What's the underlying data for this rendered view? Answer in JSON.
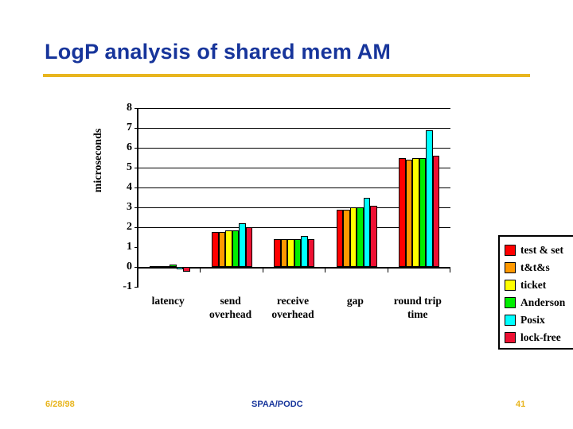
{
  "slide": {
    "title": "LogP analysis of shared mem AM",
    "title_color": "#17359b",
    "rule_color": "#e8b51e"
  },
  "footer": {
    "date": "6/28/98",
    "center": "SPAA/PODC",
    "page": "41",
    "date_color": "#e8b51e",
    "center_color": "#17359b",
    "page_color": "#e8b51e"
  },
  "chart_data": {
    "type": "bar",
    "title": "",
    "xlabel": "",
    "ylabel": "microseconds",
    "ylim": [
      -1,
      8
    ],
    "yticks": [
      8,
      7,
      6,
      5,
      4,
      3,
      2,
      1,
      0,
      -1
    ],
    "ytick_labels": [
      "8",
      "7",
      "6",
      "5",
      "4",
      "3",
      "2",
      "1",
      "0",
      "-1"
    ],
    "grid": true,
    "grid_values": [
      8,
      7,
      6,
      5,
      4,
      3,
      2,
      0
    ],
    "legend_position": "right",
    "categories": [
      "latency",
      "send overhead",
      "receive overhead",
      "gap",
      "round trip time"
    ],
    "series": [
      {
        "name": "test & set",
        "color": "#ff0000",
        "values": [
          0.05,
          1.75,
          1.4,
          2.9,
          5.5
        ]
      },
      {
        "name": "t&t&s",
        "color": "#ff9900",
        "values": [
          0.05,
          1.75,
          1.4,
          2.9,
          5.4
        ]
      },
      {
        "name": "ticket",
        "color": "#ffff00",
        "values": [
          0.05,
          1.85,
          1.4,
          3.0,
          5.5
        ]
      },
      {
        "name": "Anderson",
        "color": "#00ee00",
        "values": [
          0.12,
          1.85,
          1.4,
          3.0,
          5.5
        ]
      },
      {
        "name": "Posix",
        "color": "#00ffff",
        "values": [
          0.0,
          2.2,
          1.55,
          3.5,
          6.9
        ]
      },
      {
        "name": "lock-free",
        "color": "#ee1133",
        "values": [
          -0.22,
          2.0,
          1.4,
          3.1,
          5.6
        ]
      }
    ]
  }
}
